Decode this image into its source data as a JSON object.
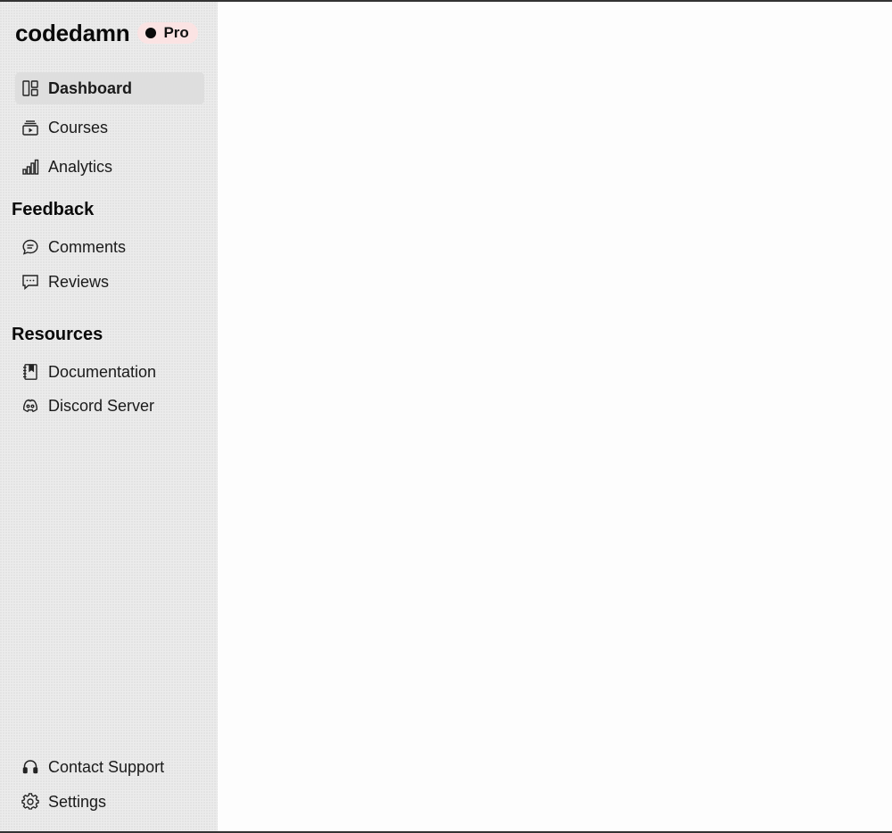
{
  "brand": {
    "name": "codedamn",
    "badge": "Pro"
  },
  "nav": {
    "main": [
      {
        "label": "Dashboard",
        "icon": "dashboard-icon",
        "active": true
      },
      {
        "label": "Courses",
        "icon": "courses-icon",
        "active": false
      },
      {
        "label": "Analytics",
        "icon": "analytics-icon",
        "active": false
      }
    ],
    "feedback_title": "Feedback",
    "feedback": [
      {
        "label": "Comments",
        "icon": "comments-icon"
      },
      {
        "label": "Reviews",
        "icon": "reviews-icon"
      }
    ],
    "resources_title": "Resources",
    "resources": [
      {
        "label": "Documentation",
        "icon": "documentation-icon"
      },
      {
        "label": "Discord Server",
        "icon": "discord-icon"
      }
    ],
    "footer": [
      {
        "label": "Contact Support",
        "icon": "headset-icon"
      },
      {
        "label": "Settings",
        "icon": "gear-icon"
      }
    ]
  },
  "colors": {
    "sidebar_bg": "#ececec",
    "active_item_bg": "#dedede",
    "badge_bg": "#fbe3e3",
    "main_bg": "#fdfdfd"
  }
}
